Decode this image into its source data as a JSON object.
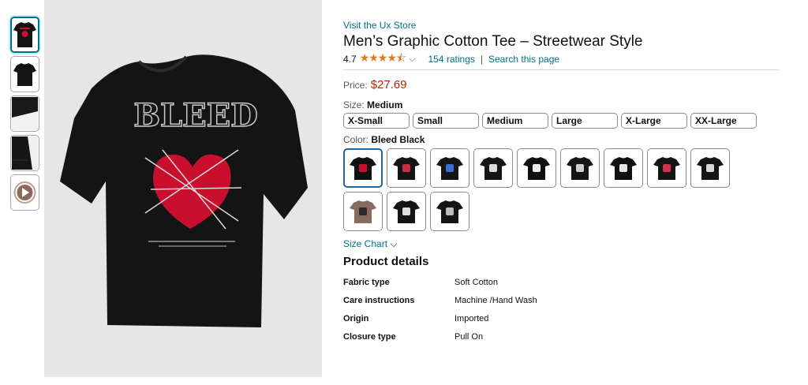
{
  "thumbnails": [
    {
      "name": "thumb-front-print",
      "selected": true
    },
    {
      "name": "thumb-plain-front"
    },
    {
      "name": "thumb-fabric-closeup"
    },
    {
      "name": "thumb-sleeve-closeup"
    },
    {
      "name": "thumb-video"
    }
  ],
  "product": {
    "store_link": "Visit the Ux Store",
    "title": "Men’s Graphic Cotton Tee – Streetwear Style",
    "rating": "4.7",
    "stars": "★★★★⯪",
    "ratings_count": "154 ratings",
    "separator": "|",
    "search_link": "Search this page",
    "price_label": "Price:",
    "price": "$27.69"
  },
  "size": {
    "label": "Size:",
    "selected": "Medium",
    "options": [
      "X-Small",
      "Small",
      "Medium",
      "Large",
      "X-Large",
      "XX-Large"
    ]
  },
  "color": {
    "label": "Color:",
    "selected": "Bleed Black",
    "swatches": [
      {
        "shirt": "#111111",
        "print": "#c8102e",
        "selected": true
      },
      {
        "shirt": "#151515",
        "print": "#c03040"
      },
      {
        "shirt": "#151515",
        "print": "#3a6fd8"
      },
      {
        "shirt": "#151515",
        "print": "#dddddd"
      },
      {
        "shirt": "#111111",
        "print": "#eeeeee"
      },
      {
        "shirt": "#151515",
        "print": "#cfcfcf"
      },
      {
        "shirt": "#111111",
        "print": "#e6e6e6"
      },
      {
        "shirt": "#151515",
        "print": "#d0304a"
      },
      {
        "shirt": "#151515",
        "print": "#d8d8d8"
      },
      {
        "shirt": "#8a6c5e",
        "print": "#2a2a2a"
      },
      {
        "shirt": "#151515",
        "print": "#e0e0e0"
      },
      {
        "shirt": "#151515",
        "print": "#bfbfbf"
      }
    ]
  },
  "size_chart": {
    "label": "Size Chart",
    "icon": "chevron-down-icon"
  },
  "details": {
    "title": "Product details",
    "rows": [
      {
        "key": "Fabric type",
        "value": "Soft Cotton"
      },
      {
        "key": "Care instructions",
        "value": "Machine /Hand Wash"
      },
      {
        "key": "Origin",
        "value": "Imported"
      },
      {
        "key": "Closure type",
        "value": "Pull On"
      }
    ]
  },
  "main_image": {
    "graphic_text": "BLEED",
    "colors": {
      "shirt": "#141414",
      "heart": "#c8102e",
      "background": "#e6e6e6"
    }
  }
}
